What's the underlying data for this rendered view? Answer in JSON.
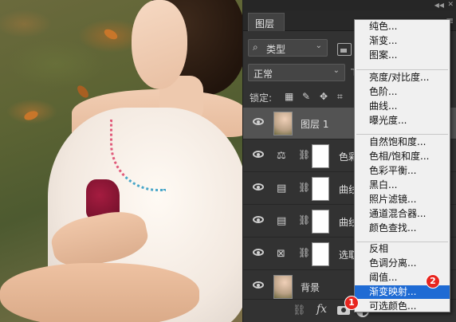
{
  "panel": {
    "tab_label": "图层",
    "filter_kind": "类型",
    "blend_mode": "正常",
    "lock_label": "锁定:"
  },
  "layers": [
    {
      "name": "图层 1",
      "kind": "pixel",
      "selected": true
    },
    {
      "name": "色彩",
      "kind": "balance",
      "selected": false
    },
    {
      "name": "曲线",
      "kind": "curves",
      "selected": false
    },
    {
      "name": "曲线",
      "kind": "curves",
      "selected": false
    },
    {
      "name": "选取",
      "kind": "selective",
      "selected": false
    },
    {
      "name": "背景",
      "kind": "background",
      "selected": false
    }
  ],
  "menu": {
    "group1": [
      "纯色...",
      "渐变...",
      "图案..."
    ],
    "group2": [
      "亮度/对比度...",
      "色阶...",
      "曲线...",
      "曝光度..."
    ],
    "group3": [
      "自然饱和度...",
      "色相/饱和度...",
      "色彩平衡...",
      "黑白...",
      "照片滤镜...",
      "通道混合器...",
      "颜色查找..."
    ],
    "group4": [
      "反相",
      "色调分离...",
      "阈值...",
      "渐变映射...",
      "可选颜色..."
    ],
    "highlighted": "渐变映射..."
  },
  "badges": {
    "one": "1",
    "two": "2"
  },
  "colors": {
    "highlight": "#1f6bd4",
    "badge": "#e8251f",
    "panel_bg": "#323232"
  }
}
